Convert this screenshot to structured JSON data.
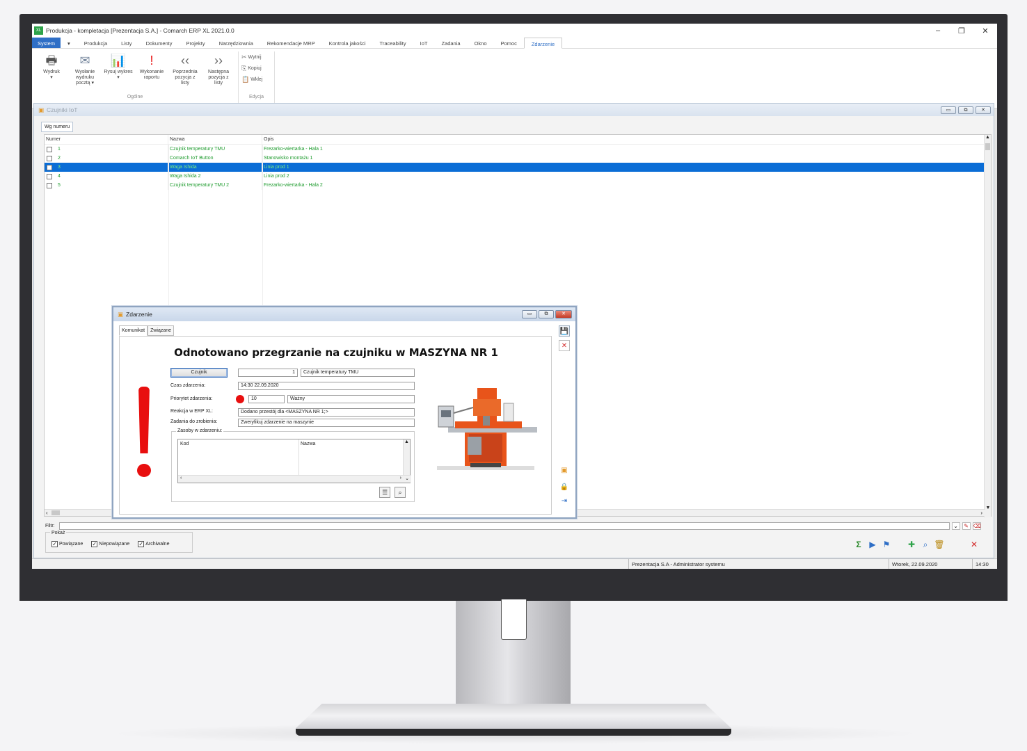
{
  "app": {
    "title": "Produkcja - kompletacja [Prezentacja S.A.] - Comarch ERP XL 2021.0.0",
    "icon_text": "XL",
    "window_controls": [
      "–",
      "❐",
      "✕"
    ]
  },
  "menu": {
    "system": "System",
    "arrow": "▾",
    "items": [
      "Produkcja",
      "Listy",
      "Dokumenty",
      "Projekty",
      "Narzędziownia",
      "Rekomendacje MRP",
      "Kontrola jakości",
      "Traceability",
      "IoT",
      "Zadania",
      "Okno",
      "Pomoc"
    ],
    "active": "Zdarzenie"
  },
  "ribbon": {
    "groups": [
      {
        "label": "Ogólne",
        "buttons": [
          {
            "label": "Wydruk",
            "sub": "▾",
            "icon": "printer-icon",
            "glyph": "🖶"
          },
          {
            "label": "Wysłanie wydruku pocztą ▾",
            "sub": "",
            "icon": "envelope-icon",
            "glyph": "✉"
          },
          {
            "label": "Rysuj wykres ▾",
            "sub": "",
            "icon": "chart-icon",
            "glyph": "📊"
          },
          {
            "label": "Wykonanie raportu",
            "sub": "",
            "icon": "exclamation-icon",
            "glyph": "!"
          },
          {
            "label": "Poprzednia pozycja z listy",
            "sub": "",
            "icon": "previous-icon",
            "glyph": "‹‹"
          },
          {
            "label": "Następna pozycja z listy",
            "sub": "",
            "icon": "next-icon",
            "glyph": "››"
          }
        ]
      },
      {
        "label": "Edycja",
        "small": [
          {
            "label": "Wytnij",
            "glyph": "✂"
          },
          {
            "label": "Kopiuj",
            "glyph": "⎘"
          },
          {
            "label": "Wklej",
            "glyph": "📋"
          }
        ]
      }
    ]
  },
  "iot_window": {
    "title": "Czujniki IoT",
    "controls": [
      "▭",
      "⧉",
      "✕"
    ],
    "tab": "Wg numeru",
    "columns": [
      "Numer",
      "Nazwa",
      "Opis"
    ],
    "rows": [
      {
        "num": "1",
        "name": "Czujnik temperatury TMU",
        "desc": "Frezarko-wiertarka - Hala 1",
        "selected": false
      },
      {
        "num": "2",
        "name": "Comarch IoT Button",
        "desc": "Stanowisko montażu 1",
        "selected": false
      },
      {
        "num": "3",
        "name": "Waga Ishida",
        "desc": "Linia prod 1",
        "selected": true
      },
      {
        "num": "4",
        "name": "Waga Ishida 2",
        "desc": "Linia prod 2",
        "selected": false
      },
      {
        "num": "5",
        "name": "Czujnik temperatury TMU 2",
        "desc": "Frezarko-wiertarka - Hala 2",
        "selected": false
      }
    ],
    "filter_label": "Filtr:",
    "pokaz_label": "Pokaż",
    "pokaz_items": [
      "Powiązane",
      "Niepowiązane",
      "Archiwalne"
    ]
  },
  "dialog": {
    "title": "Zdarzenie",
    "tabs": [
      "Komunikat",
      "Związane"
    ],
    "headline": "Odnotowano przegrzanie na czujniku w MASZYNA NR 1",
    "czujnik_button": "Czujnik",
    "czujnik_num": "1",
    "czujnik_name": "Czujnik temperatury TMU",
    "czas_label": "Czas zdarzenia:",
    "czas_value": "14:30 22.09.2020",
    "priorytet_label": "Priorytet zdarzenia:",
    "priorytet_value": "10",
    "priorytet_name": "Ważny",
    "reakcja_label": "Reakcja w ERP XL:",
    "reakcja_value": "Dodano przestój dla <MASZYNA NR 1;>",
    "zadania_label": "Zadania do zrobienia:",
    "zadania_value": "Zweryfikuj zdarzenie na maszynie",
    "zasoby_label": "Zasoby w zdarzeniu:",
    "zasoby_columns": [
      "Kod",
      "Nazwa"
    ]
  },
  "status": {
    "company": "Prezentacja S.A - Administrator systemu",
    "date": "Wtorek, 22.09.2020",
    "time": "14:30"
  },
  "colors": {
    "accent": "#2f6fc6",
    "selection": "#0a6dd6",
    "row_text": "#1d9b2d",
    "alert_red": "#e80f0f"
  }
}
